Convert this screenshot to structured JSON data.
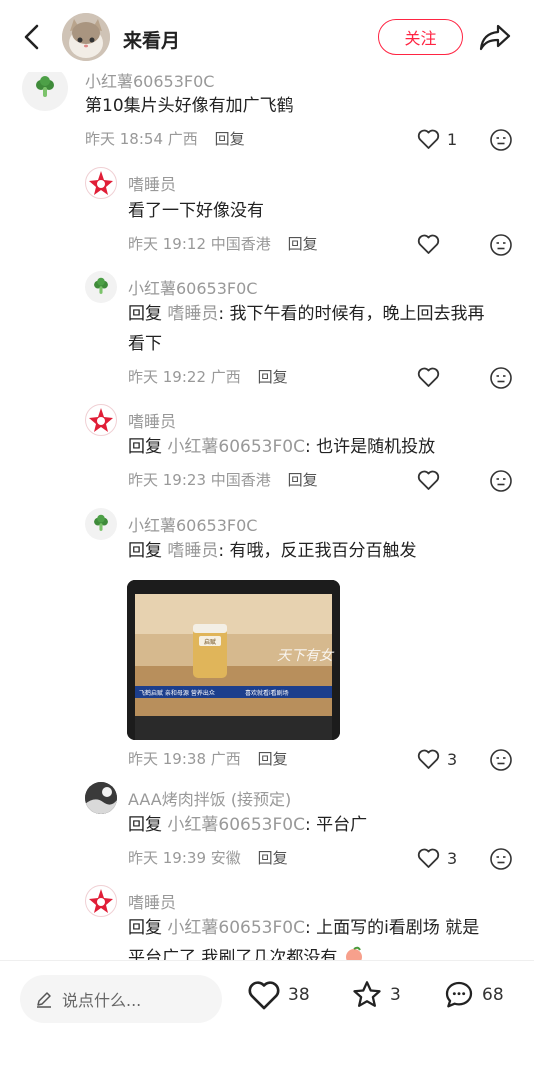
{
  "header": {
    "username": "来看月",
    "follow_label": "关注"
  },
  "comments": [
    {
      "username": "小红薯60653F0C",
      "text": "第10集片头好像有加广飞鹤",
      "time": "昨天 18:54",
      "location": "广西",
      "reply_label": "回复",
      "likes": "1"
    },
    {
      "username": "嗜睡员",
      "text": "看了一下好像没有",
      "time": "昨天 19:12",
      "location": "中国香港",
      "reply_label": "回复",
      "likes": ""
    },
    {
      "username": "小红薯60653F0C",
      "reply_prefix": "回复",
      "mention": "嗜睡员",
      "text_line1": ": 我下午看的时候有，晚上回去我再",
      "text_line2": "看下",
      "time": "昨天 19:22",
      "location": "广西",
      "reply_label": "回复",
      "likes": ""
    },
    {
      "username": "嗜睡员",
      "reply_prefix": "回复",
      "mention": "小红薯60653F0C",
      "text": ": 也许是随机投放",
      "time": "昨天 19:23",
      "location": "中国香港",
      "reply_label": "回复",
      "likes": ""
    },
    {
      "username": "小红薯60653F0C",
      "reply_prefix": "回复",
      "mention": "嗜睡员",
      "text": ": 有哦，反正我百分百触发",
      "time": "昨天 19:38",
      "location": "广西",
      "reply_label": "回复",
      "likes": "3"
    },
    {
      "username": "AAA烤肉拌饭 (接预定)",
      "reply_prefix": "回复",
      "mention": "小红薯60653F0C",
      "text": ": 平台广",
      "time": "昨天 19:39",
      "location": "安徽",
      "reply_label": "回复",
      "likes": "3"
    },
    {
      "username": "嗜睡员",
      "reply_prefix": "回复",
      "mention": "小红薯60653F0C",
      "text_line1": ": 上面写的i看剧场 就是",
      "text_line2": "平台广了 我刷了几次都没有"
    }
  ],
  "photo": {
    "ticker_text": "飞鹤启赋 亲和母源 营养出众",
    "ticker_text2": "喜欢就看i看剧场",
    "overlay_script": "天下有女",
    "product_label": "启赋"
  },
  "bottom_bar": {
    "input_placeholder": "说点什么...",
    "likes": "38",
    "stars": "3",
    "comments": "68"
  },
  "colors": {
    "accent": "#ff2442",
    "muted": "#999999",
    "text": "#222222"
  }
}
